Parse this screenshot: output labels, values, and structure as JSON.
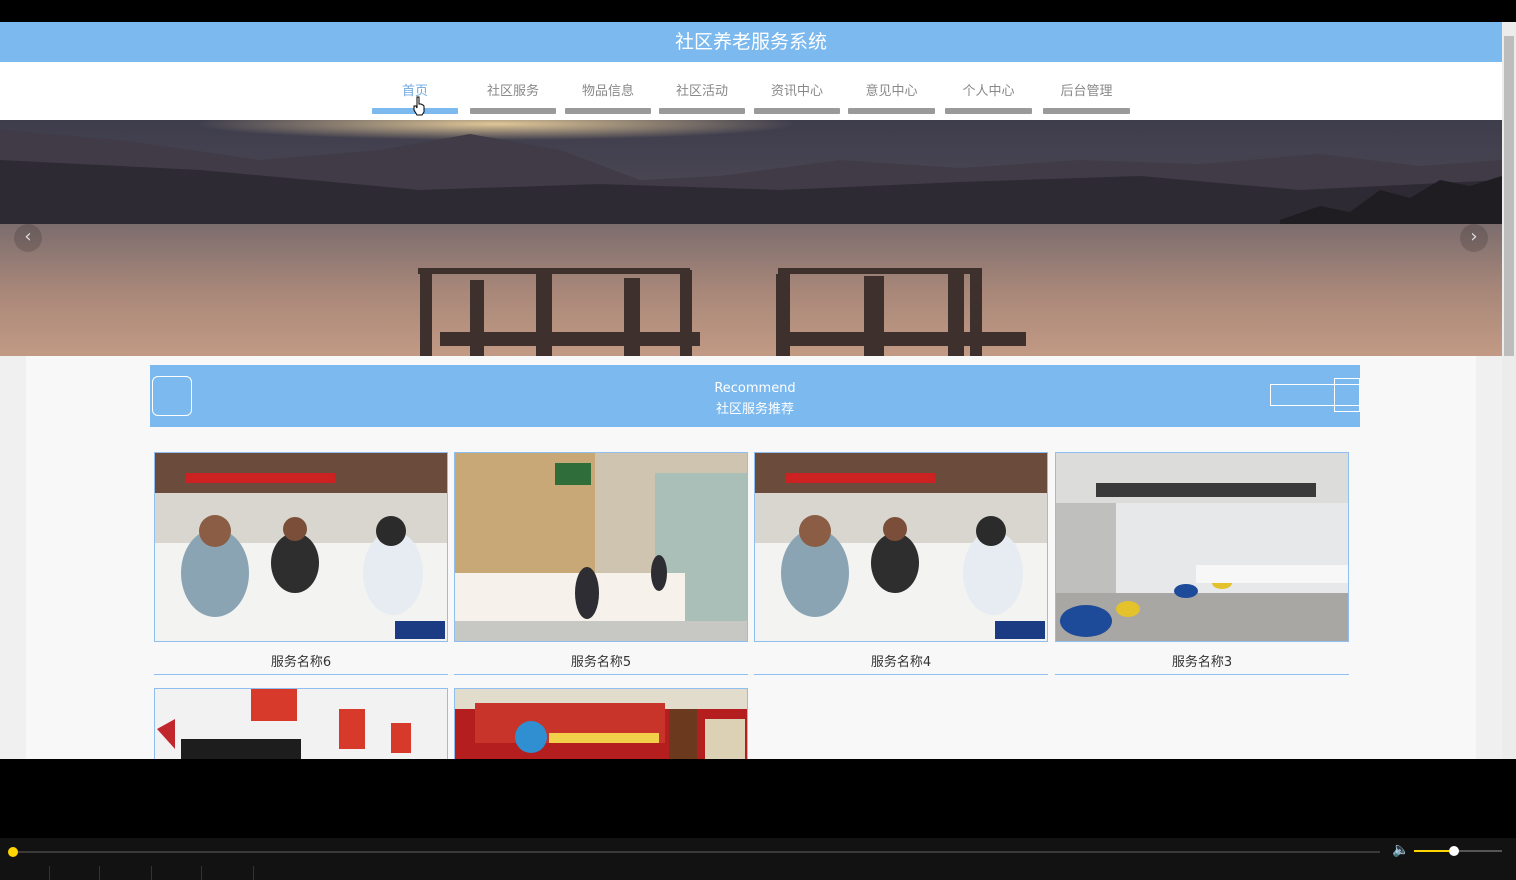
{
  "site_title": "社区养老服务系统",
  "nav": {
    "items": [
      {
        "label": "首页",
        "active": true
      },
      {
        "label": "社区服务",
        "active": false
      },
      {
        "label": "物品信息",
        "active": false
      },
      {
        "label": "社区活动",
        "active": false
      },
      {
        "label": "资讯中心",
        "active": false
      },
      {
        "label": "意见中心",
        "active": false
      },
      {
        "label": "个人中心",
        "active": false
      },
      {
        "label": "后台管理",
        "active": false
      }
    ]
  },
  "banner": {
    "prev_icon": "chevron-left-icon",
    "next_icon": "chevron-right-icon"
  },
  "recommend": {
    "title_en": "Recommend",
    "title_cn": "社区服务推荐",
    "items": [
      {
        "name": "服务名称6",
        "image": "service-hall-photo"
      },
      {
        "name": "服务名称5",
        "image": "service-counter-photo"
      },
      {
        "name": "服务名称4",
        "image": "service-hall-photo"
      },
      {
        "name": "服务名称3",
        "image": "modern-lobby-photo"
      },
      {
        "name": "",
        "image": "labor-security-office-photo"
      },
      {
        "name": "",
        "image": "service-center-photo"
      }
    ]
  },
  "player": {
    "progress": 0.0,
    "volume": 0.45,
    "volume_icon": "speaker-icon"
  },
  "colors": {
    "accent": "#7bb9ee",
    "nav_bar_inactive": "#9a9a9a",
    "player_accent": "#ffd400"
  }
}
